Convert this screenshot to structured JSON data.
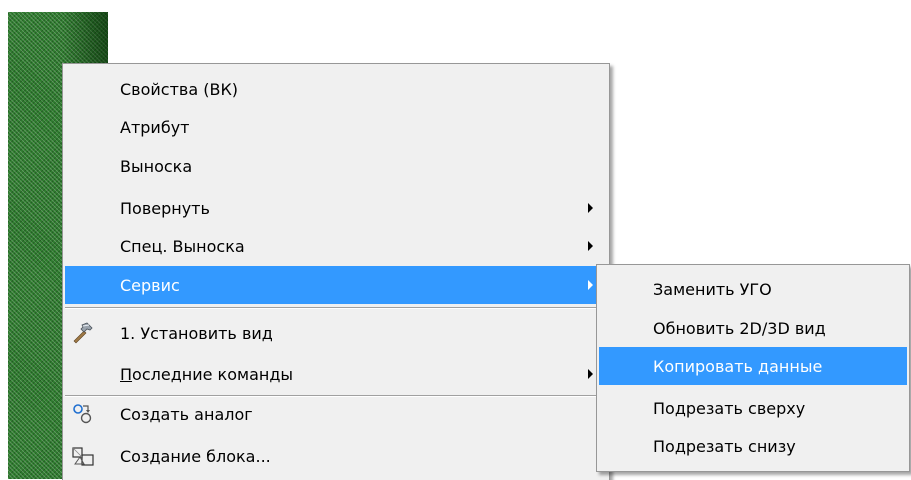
{
  "main_menu": {
    "items": [
      {
        "label": "Свойства (ВК)"
      },
      {
        "label": "Атрибут"
      },
      {
        "label": "Выноска"
      },
      {
        "label": "Повернуть"
      },
      {
        "label": "Спец. Выноска"
      },
      {
        "label": "Сервис"
      },
      {
        "label": "1. Установить вид",
        "icon": "hammer-icon"
      },
      {
        "label_underlined": "П",
        "label_rest": "оследние команды"
      },
      {
        "label": "Создать аналог",
        "icon": "create-analog-icon"
      },
      {
        "label": "Создание блока...",
        "icon": "create-block-icon"
      }
    ]
  },
  "sub_menu": {
    "items": [
      {
        "label": "Заменить УГО"
      },
      {
        "label": "Обновить 2D/3D вид"
      },
      {
        "label": "Копировать данные"
      },
      {
        "label": "Подрезать сверху"
      },
      {
        "label": "Подрезать снизу"
      }
    ]
  },
  "colors": {
    "highlight": "#3399ff",
    "menu_bg": "#f0f0f0",
    "strip_green": "#2f7d2f"
  }
}
